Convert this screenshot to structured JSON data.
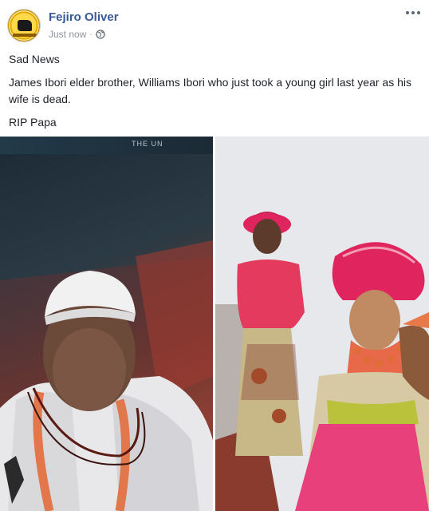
{
  "post": {
    "author": "Fejiro Oliver",
    "timestamp": "Just now",
    "separator": "·",
    "privacy_icon": "globe-icon",
    "more_icon": "more-options-icon",
    "paragraphs": [
      "Sad News",
      "James Ibori elder brother, Williams Ibori who just took a young girl last year as his wife is dead.",
      "RIP Papa"
    ]
  },
  "photos": {
    "left_caption": "THE UN"
  },
  "colors": {
    "author_link": "#385898",
    "meta_text": "#90949c",
    "body_text": "#1d2129",
    "gele_red": "#e0245e"
  }
}
